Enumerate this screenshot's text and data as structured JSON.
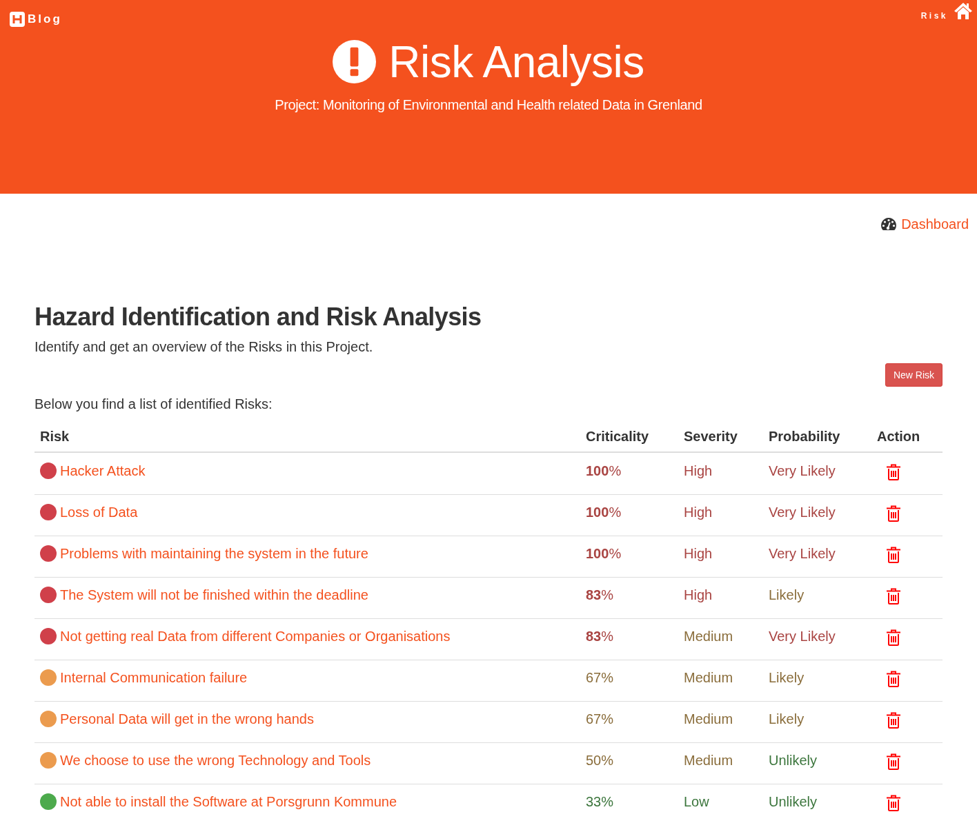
{
  "header": {
    "logo": {
      "text": "Blog"
    },
    "nav": {
      "label": "Risk"
    },
    "title": "Risk Analysis",
    "subtitle": "Project: Monitoring of Environmental and Health related Data in Grenland"
  },
  "toolbar": {
    "dashboard_link": "Dashboard"
  },
  "section": {
    "heading": "Hazard Identification and Risk Analysis",
    "intro": "Identify and get an overview of the Risks in this Project.",
    "new_button": "New Risk",
    "list_caption": "Below you find a list of identified Risks:"
  },
  "table": {
    "columns": [
      "Risk",
      "Criticality",
      "Severity",
      "Probability",
      "Action"
    ],
    "rows": [
      {
        "color": "#d0404a",
        "risk": "Hacker Attack",
        "criticality": {
          "text": "**100**%",
          "kind": "high"
        },
        "severity": {
          "text": "High",
          "kind": "high"
        },
        "probability": {
          "text": "Very Likely",
          "kind": "high"
        }
      },
      {
        "color": "#d0404a",
        "risk": "Loss of Data",
        "criticality": {
          "text": "**100**%",
          "kind": "high"
        },
        "severity": {
          "text": "High",
          "kind": "high"
        },
        "probability": {
          "text": "Very Likely",
          "kind": "high"
        }
      },
      {
        "color": "#d0404a",
        "risk": "Problems with maintaining the system in the future",
        "criticality": {
          "text": "**100**%",
          "kind": "high"
        },
        "severity": {
          "text": "High",
          "kind": "high"
        },
        "probability": {
          "text": "Very Likely",
          "kind": "high"
        }
      },
      {
        "color": "#d0404a",
        "risk": "The System will not be finished within the deadline",
        "criticality": {
          "text": "**83**%",
          "kind": "high"
        },
        "severity": {
          "text": "High",
          "kind": "high"
        },
        "probability": {
          "text": "Likely",
          "kind": "medium"
        }
      },
      {
        "color": "#d0404a",
        "risk": "Not getting real Data from different Companies or Organisations",
        "criticality": {
          "text": "**83**%",
          "kind": "high"
        },
        "severity": {
          "text": "Medium",
          "kind": "medium"
        },
        "probability": {
          "text": "Very Likely",
          "kind": "high"
        }
      },
      {
        "color": "#eb9b4e",
        "risk": "Internal Communication failure",
        "criticality": {
          "text": "67%",
          "kind": "medium"
        },
        "severity": {
          "text": "Medium",
          "kind": "medium"
        },
        "probability": {
          "text": "Likely",
          "kind": "medium"
        }
      },
      {
        "color": "#eb9b4e",
        "risk": "Personal Data will get in the wrong hands",
        "criticality": {
          "text": "67%",
          "kind": "medium"
        },
        "severity": {
          "text": "Medium",
          "kind": "medium"
        },
        "probability": {
          "text": "Likely",
          "kind": "medium"
        }
      },
      {
        "color": "#eb9b4e",
        "risk": "We choose to use the wrong Technology and Tools",
        "criticality": {
          "text": "50%",
          "kind": "medium"
        },
        "severity": {
          "text": "Medium",
          "kind": "medium"
        },
        "probability": {
          "text": "Unlikely",
          "kind": "low"
        }
      },
      {
        "color": "#4caa4c",
        "risk": "Not able to install the Software at Porsgrunn Kommune",
        "criticality": {
          "text": "33%",
          "kind": "low"
        },
        "severity": {
          "text": "Low",
          "kind": "low"
        },
        "probability": {
          "text": "Unlikely",
          "kind": "low"
        }
      }
    ]
  }
}
